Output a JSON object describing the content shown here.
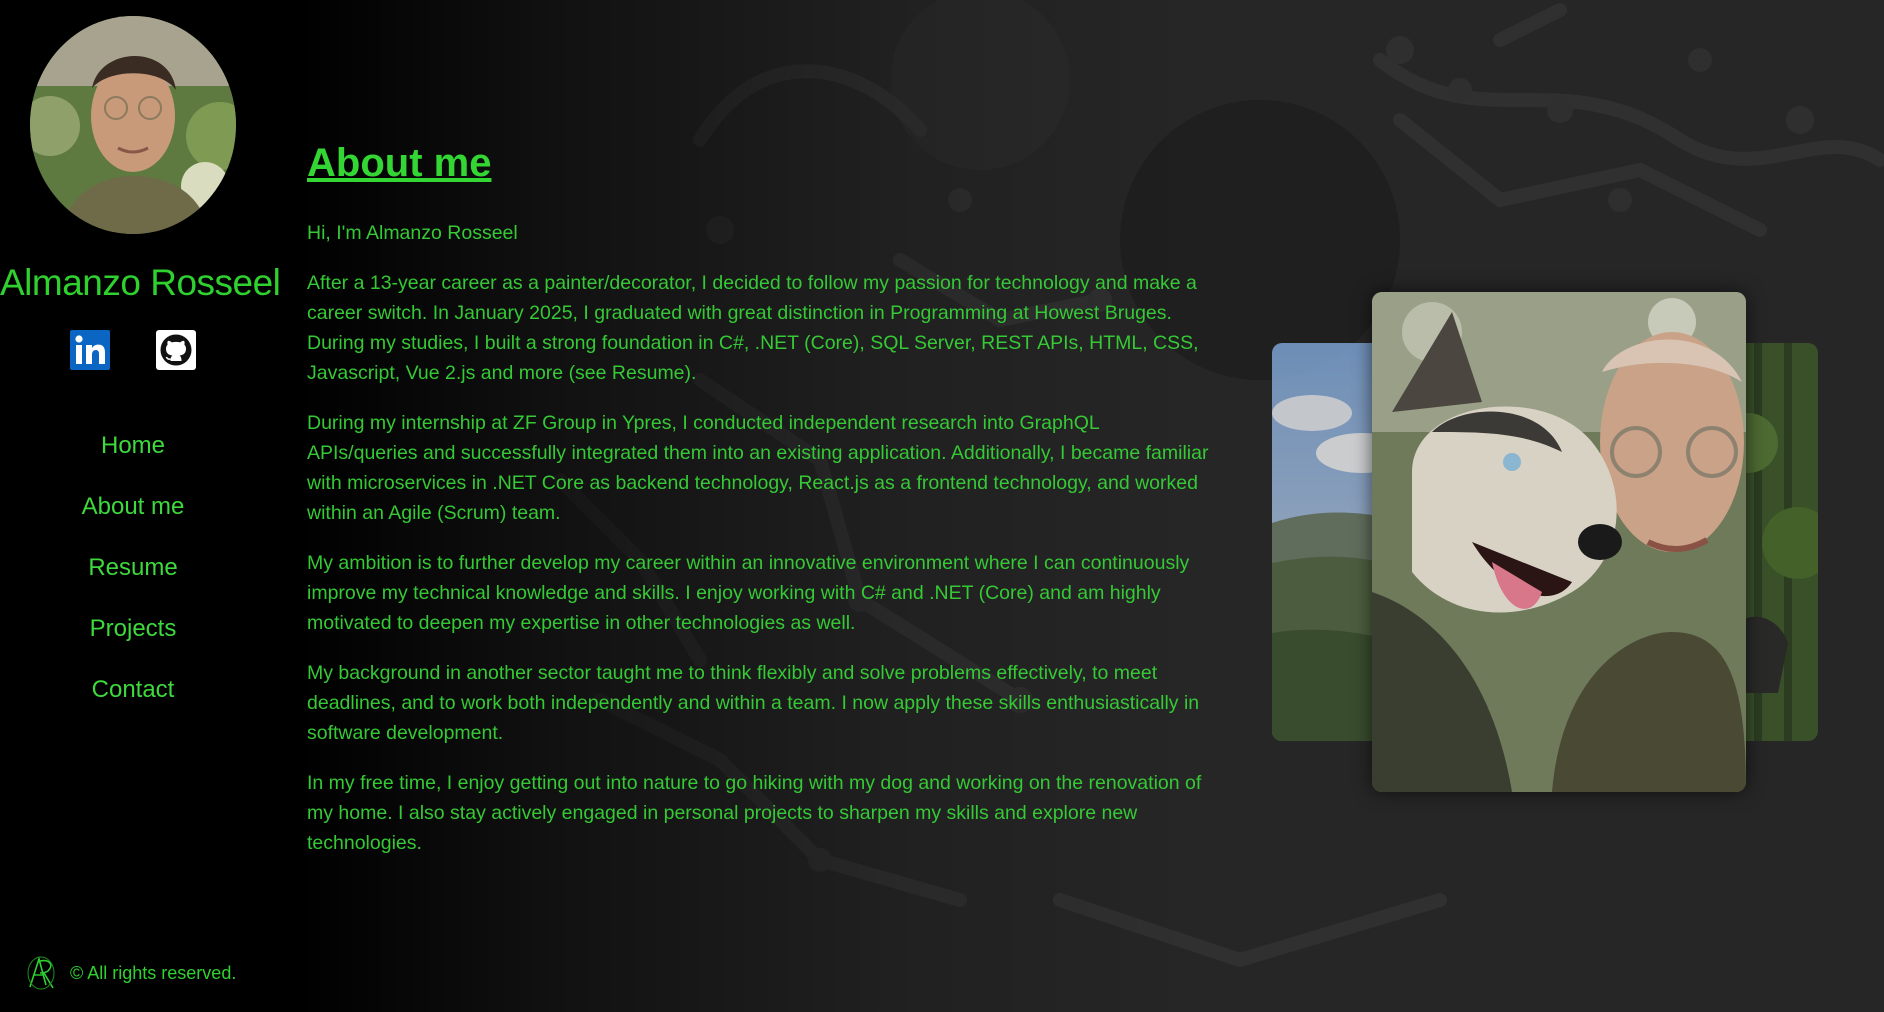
{
  "sidebar": {
    "name": "Almanzo Rosseel",
    "social": [
      {
        "name": "LinkedIn",
        "icon": "linkedin-icon"
      },
      {
        "name": "GitHub",
        "icon": "github-icon"
      }
    ],
    "nav": [
      {
        "label": "Home"
      },
      {
        "label": "About me"
      },
      {
        "label": "Resume"
      },
      {
        "label": "Projects"
      },
      {
        "label": "Contact"
      }
    ],
    "footer": {
      "logo_icon": "ar-monogram-logo",
      "text": "© All rights reserved."
    }
  },
  "main": {
    "title": "About me",
    "paragraphs": [
      "Hi, I'm Almanzo Rosseel",
      "After a 13-year career as a painter/decorator, I decided to follow my passion for technology and make a career switch. In January 2025, I graduated with great distinction in Programming at Howest Bruges. During my studies, I built a strong foundation in C#, .NET (Core), SQL Server, REST APIs, HTML, CSS, Javascript, Vue 2.js and more (see Resume).",
      "During my internship at ZF Group in Ypres, I conducted independent research into GraphQL APIs/queries and successfully integrated them into an existing application. Additionally, I became familiar with microservices in .NET Core as backend technology, React.js as a frontend technology, and worked within an Agile (Scrum) team.",
      "My ambition is to further develop my career within an innovative environment where I can continuously improve my technical knowledge and skills. I enjoy working with C# and .NET (Core) and am highly motivated to deepen my expertise in other technologies as well.",
      "My background in another sector taught me to think flexibly and solve problems effectively, to meet deadlines, and to work both independently and within a team. I now apply these skills enthusiastically in software development.",
      "In my free time, I enjoy getting out into nature to go hiking with my dog and working on the renovation of my home. I also stay actively engaged in personal projects to sharpen my skills and explore new technologies."
    ]
  },
  "colors": {
    "accent": "#33d633",
    "sidebar_bg": "#000000",
    "page_bg": "#262626"
  }
}
